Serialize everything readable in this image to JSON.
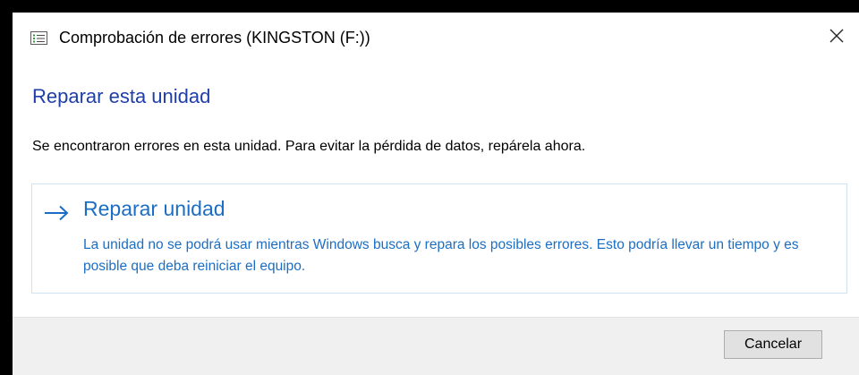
{
  "window": {
    "title": "Comprobación de errores (KINGSTON (F:))",
    "app_icon": "checklist-icon",
    "close_icon": "close-icon"
  },
  "main": {
    "heading": "Reparar esta unidad",
    "message": "Se encontraron errores en esta unidad. Para evitar la pérdida de datos, repárela ahora."
  },
  "command_link": {
    "icon": "arrow-right-icon",
    "title": "Reparar unidad",
    "description": "La unidad no se podrá usar mientras Windows busca y repara los posibles errores. Esto podría llevar un tiempo y es posible que deba reiniciar el equipo."
  },
  "footer": {
    "cancel_label": "Cancelar"
  },
  "colors": {
    "heading": "#1f3fa8",
    "link": "#1c6ec4",
    "footer_bg": "#f0f0f0",
    "frame": "#000000"
  }
}
